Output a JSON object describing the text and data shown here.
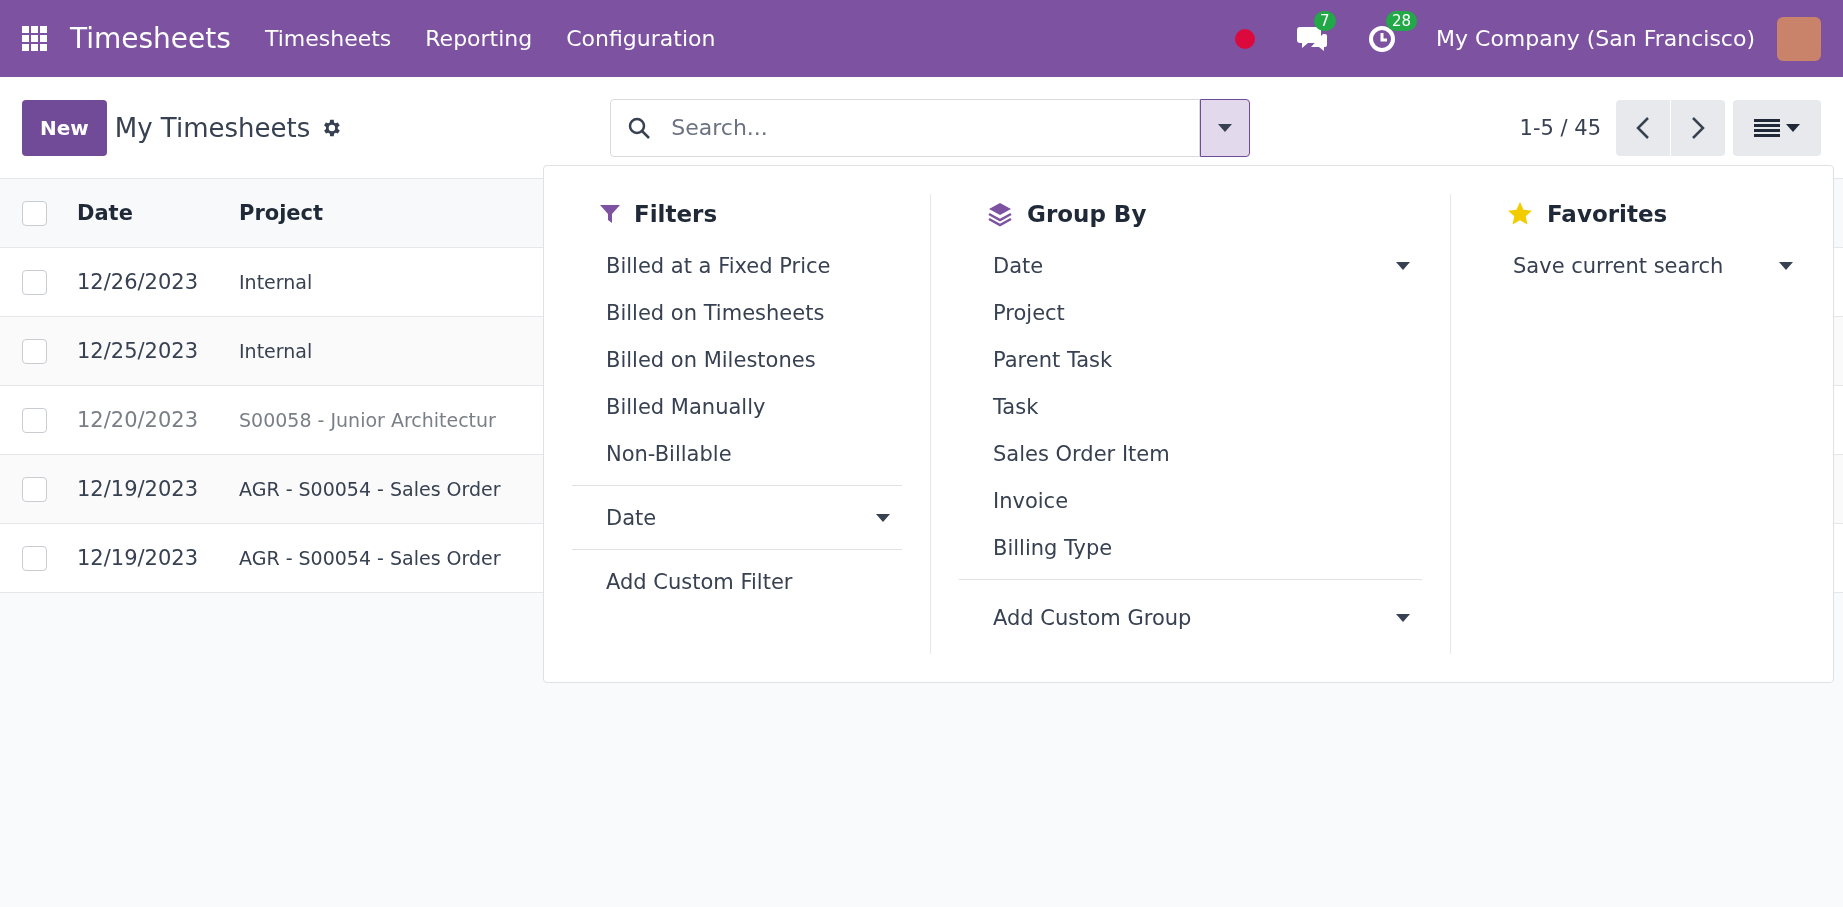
{
  "navbar": {
    "app_name": "Timesheets",
    "menu": [
      "Timesheets",
      "Reporting",
      "Configuration"
    ],
    "messages_count": "7",
    "activities_count": "28",
    "company": "My Company (San Francisco)"
  },
  "control_panel": {
    "new_button": "New",
    "title": "My Timesheets",
    "search": {
      "placeholder": "Search..."
    },
    "pager": "1-5 / 45"
  },
  "table": {
    "all_checked": false,
    "columns": [
      "Date",
      "Project"
    ],
    "rows": [
      {
        "date": "12/26/2023",
        "project": "Internal",
        "muted": false,
        "checked": false
      },
      {
        "date": "12/25/2023",
        "project": "Internal",
        "muted": false,
        "checked": false
      },
      {
        "date": "12/20/2023",
        "project": "S00058 - Junior Architectur",
        "muted": true,
        "checked": false
      },
      {
        "date": "12/19/2023",
        "project": "AGR - S00054 - Sales Order",
        "muted": false,
        "checked": false
      },
      {
        "date": "12/19/2023",
        "project": "AGR - S00054 - Sales Order",
        "muted": false,
        "checked": false
      }
    ]
  },
  "search_panel": {
    "filters": {
      "title": "Filters",
      "items": [
        "Billed at a Fixed Price",
        "Billed on Timesheets",
        "Billed on Milestones",
        "Billed Manually",
        "Non-Billable"
      ],
      "date": "Date",
      "custom": "Add Custom Filter"
    },
    "group_by": {
      "title": "Group By",
      "items": [
        {
          "label": "Date",
          "expandable": true
        },
        {
          "label": "Project",
          "expandable": false
        },
        {
          "label": "Parent Task",
          "expandable": false
        },
        {
          "label": "Task",
          "expandable": false
        },
        {
          "label": "Sales Order Item",
          "expandable": false
        },
        {
          "label": "Invoice",
          "expandable": false
        },
        {
          "label": "Billing Type",
          "expandable": false
        }
      ],
      "custom": "Add Custom Group"
    },
    "favorites": {
      "title": "Favorites",
      "save": "Save current search"
    }
  }
}
